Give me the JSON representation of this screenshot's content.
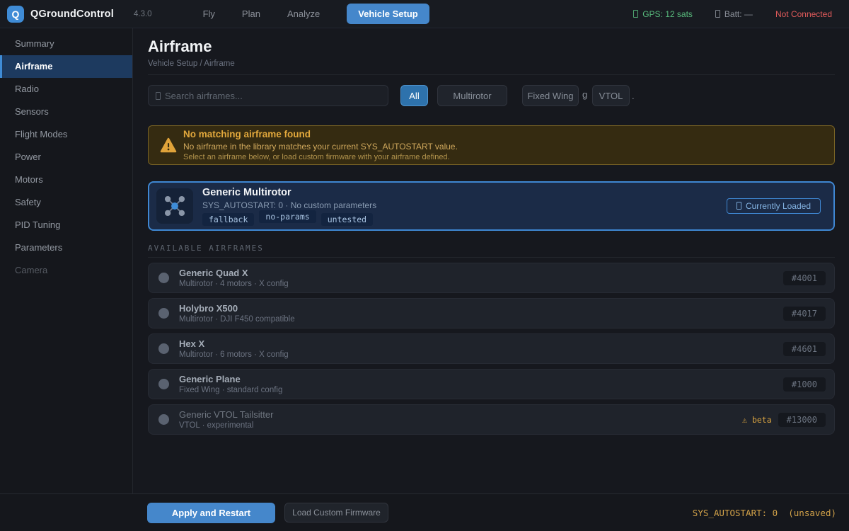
{
  "colors": {
    "accent": "#4587cb",
    "accent-border": "#5b9bd5",
    "green": "#57b87b",
    "red": "#e25b5b",
    "amber": "#dfa63e",
    "warn-bg": "#352b11",
    "warn-border": "#796325",
    "card-bg": "#1b2b47",
    "card-border": "#3f87d2"
  },
  "app": {
    "logo_letter": "Q",
    "brand": "QGroundControl",
    "version": "4.3.0"
  },
  "topbar": {
    "tabs": [
      {
        "label": "Fly"
      },
      {
        "label": "Plan"
      },
      {
        "label": "Analyze"
      },
      {
        "label": "Vehicle Setup"
      }
    ],
    "status": {
      "gps": "GPS: 12 sats",
      "battery": "Batt: —",
      "connection": "Not Connected"
    }
  },
  "sidebar": {
    "items": [
      {
        "label": "Summary"
      },
      {
        "label": "Airframe"
      },
      {
        "label": "Radio"
      },
      {
        "label": "Sensors"
      },
      {
        "label": "Flight Modes"
      },
      {
        "label": "Power"
      },
      {
        "label": "Motors"
      },
      {
        "label": "Safety"
      },
      {
        "label": "PID Tuning"
      },
      {
        "label": "Parameters"
      },
      {
        "label": "Camera"
      }
    ]
  },
  "page": {
    "title": "Airframe",
    "breadcrumb": "Vehicle Setup / Airframe"
  },
  "toolbar": {
    "search_placeholder": "Search airframes...",
    "filters": [
      {
        "label": "All"
      },
      {
        "label": "Multirotor"
      },
      {
        "label": "Fixed Wing"
      },
      {
        "label": "VTOL"
      }
    ],
    "artifact_g": "g",
    "artifact_dot": "."
  },
  "warning": {
    "title": "No matching airframe found",
    "line1": "No airframe in the library matches your current SYS_AUTOSTART value.",
    "line2": "Select an airframe below, or load custom firmware with your airframe defined."
  },
  "current": {
    "title": "Generic Multirotor",
    "subtitle": "SYS_AUTOSTART: 0 · No custom parameters",
    "tags": [
      "fallback",
      "no-params",
      "untested"
    ],
    "badge": "Currently Loaded"
  },
  "list": {
    "section_label": "AVAILABLE AIRFRAMES",
    "rows": [
      {
        "title": "Generic Quad X",
        "subtitle": "Multirotor · 4 motors · X config",
        "id": "#4001"
      },
      {
        "title": "Holybro X500",
        "subtitle": "Multirotor · DJI F450 compatible",
        "id": "#4017"
      },
      {
        "title": "Hex X",
        "subtitle": "Multirotor · 6 motors · X config",
        "id": "#4601"
      },
      {
        "title": "Generic Plane",
        "subtitle": "Fixed Wing · standard config",
        "id": "#1000"
      },
      {
        "title": "Generic VTOL Tailsitter",
        "subtitle": "VTOL · experimental",
        "id": "#13000",
        "beta": "beta"
      }
    ]
  },
  "icons": {
    "beta_warning": "⚠"
  },
  "footer": {
    "apply_label": "Apply and Restart",
    "load_label": "Load Custom Firmware",
    "status": "SYS_AUTOSTART: 0  (unsaved)"
  }
}
